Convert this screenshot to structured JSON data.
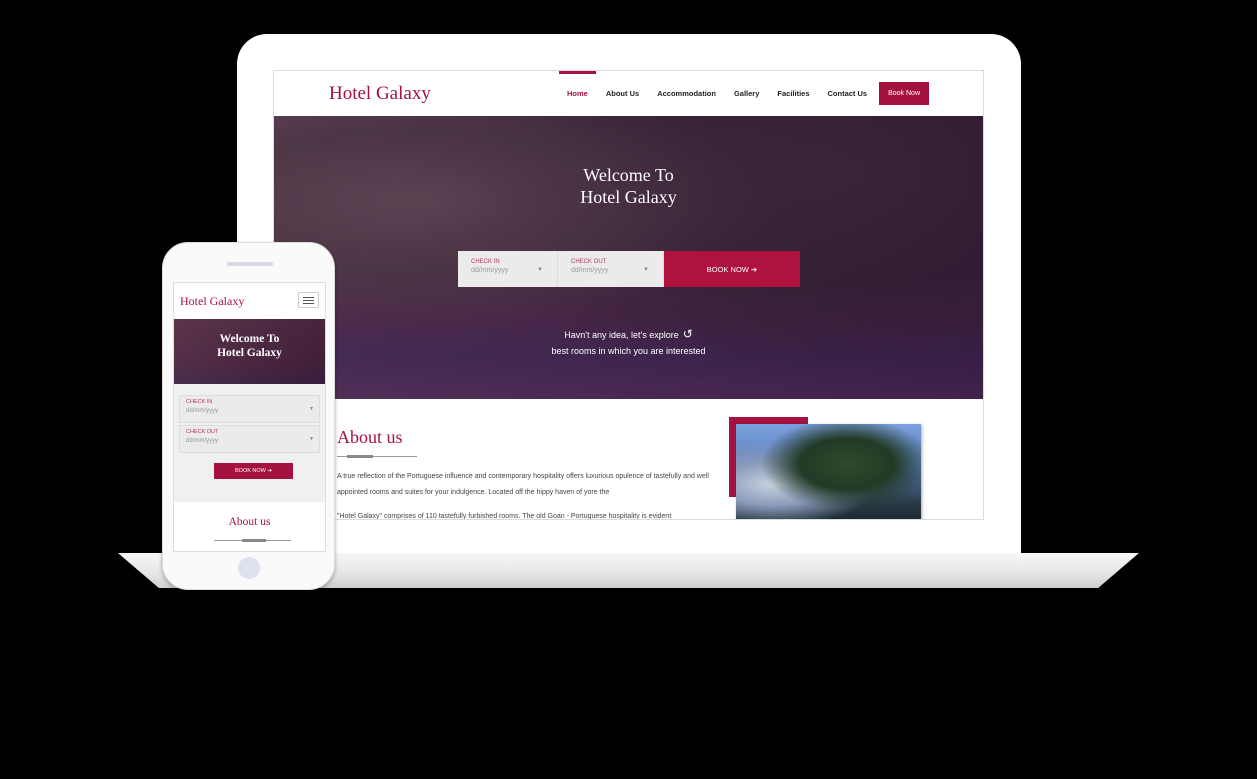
{
  "desktop": {
    "logo": "Hotel Galaxy",
    "nav": [
      {
        "label": "Home",
        "active": true
      },
      {
        "label": "About Us"
      },
      {
        "label": "Accommodation"
      },
      {
        "label": "Gallery"
      },
      {
        "label": "Facilities"
      },
      {
        "label": "Contact Us"
      }
    ],
    "book_now_nav": "Book Now",
    "hero": {
      "title_line1": "Welcome To",
      "title_line2": "Hotel Galaxy",
      "check_in_label": "CHECK IN",
      "check_in_placeholder": "dd/mm/yyyy",
      "check_out_label": "CHECK OUT",
      "check_out_placeholder": "dd/mm/yyyy",
      "book_button": "BOOK NOW ➔",
      "explore_line1": "Havn't any idea, let's explore",
      "explore_line2": "best rooms in which you are interested"
    },
    "about": {
      "heading": "About us",
      "para1": "A true reflection of the Portuguese influence and contemporary hospitality offers luxurious opulence of tastefully and well appointed rooms and suites for your indulgence. Located off the hippy haven of yore the",
      "para2": "\"Hotel Galaxy\" comprises of 110 tastefully furbished rooms. The old Goan - Portuguese hospitality is evident"
    }
  },
  "mobile": {
    "logo": "Hotel Galaxy",
    "hero_line1": "Welcome To",
    "hero_line2": "Hotel Galaxy",
    "check_in_label": "CHECK IN",
    "check_in_placeholder": "dd/mm/yyyy",
    "check_out_label": "CHECK OUT",
    "check_out_placeholder": "dd/mm/yyyy",
    "book_button": "BOOK NOW ➔",
    "about_heading": "About us"
  },
  "colors": {
    "brand": "#a4123f",
    "background": "#000000"
  }
}
